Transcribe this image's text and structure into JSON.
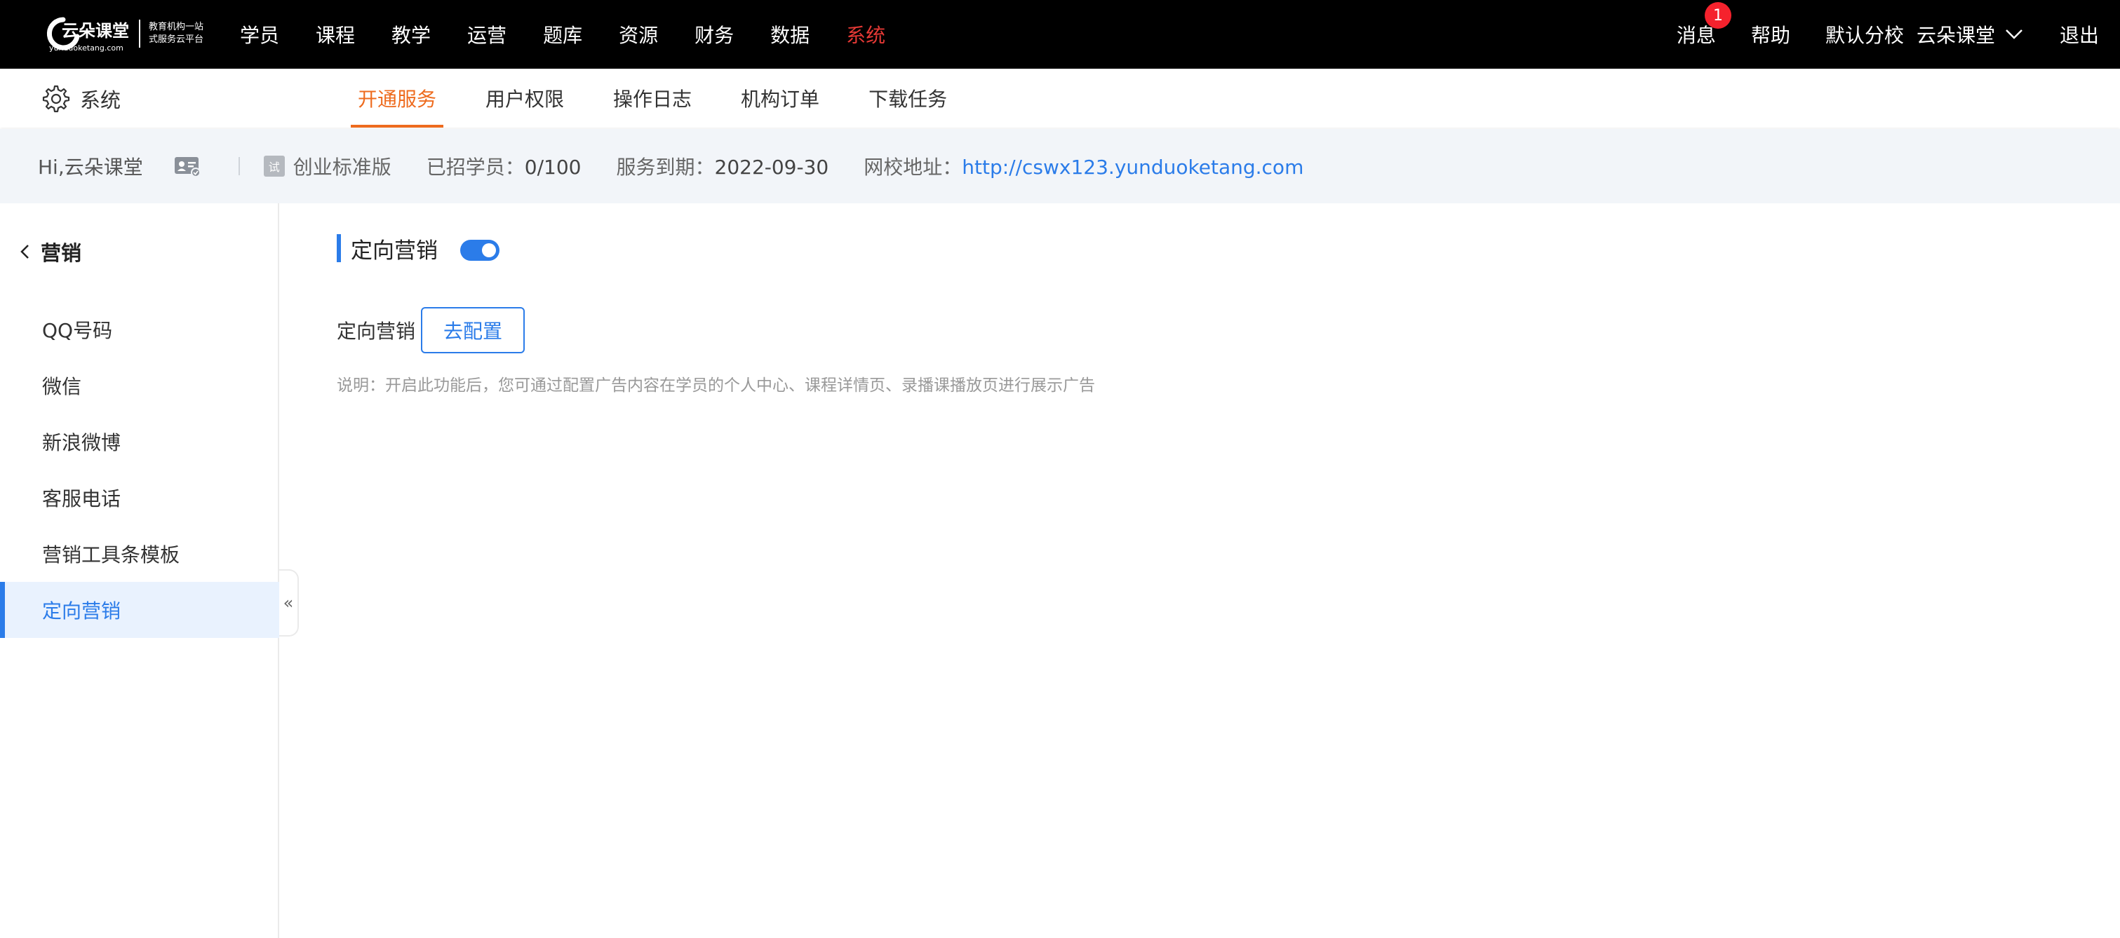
{
  "topbar": {
    "logo": {
      "name": "云朵课堂",
      "domain": "yunduoketang.com",
      "slogan_line1": "教育机构一站",
      "slogan_line2": "式服务云平台"
    },
    "nav": [
      {
        "label": "学员"
      },
      {
        "label": "课程"
      },
      {
        "label": "教学"
      },
      {
        "label": "运营"
      },
      {
        "label": "题库"
      },
      {
        "label": "资源"
      },
      {
        "label": "财务"
      },
      {
        "label": "数据"
      },
      {
        "label": "系统"
      }
    ],
    "active_nav": "系统",
    "messages_label": "消息",
    "messages_badge": "1",
    "help_label": "帮助",
    "campus_label": "默认分校",
    "account_label": "云朵课堂",
    "logout_label": "退出"
  },
  "subbar": {
    "section_label": "系统",
    "tabs": [
      {
        "label": "开通服务"
      },
      {
        "label": "用户权限"
      },
      {
        "label": "操作日志"
      },
      {
        "label": "机构订单"
      },
      {
        "label": "下载任务"
      }
    ],
    "active_tab": "开通服务"
  },
  "infobar": {
    "greeting": "Hi,云朵课堂",
    "trial_badge": "试",
    "edition": "创业标准版",
    "students_label": "已招学员：",
    "students_value": "0/100",
    "expiry_label": "服务到期：",
    "expiry_value": "2022-09-30",
    "site_label": "网校地址：",
    "site_url": "http://cswx123.yunduoketang.com"
  },
  "sidebar": {
    "back_label": "营销",
    "items": [
      {
        "label": "QQ号码"
      },
      {
        "label": "微信"
      },
      {
        "label": "新浪微博"
      },
      {
        "label": "客服电话"
      },
      {
        "label": "营销工具条模板"
      },
      {
        "label": "定向营销"
      }
    ],
    "active_item": "定向营销",
    "collapse_glyph": "«"
  },
  "main": {
    "title": "定向营销",
    "toggle_on": true,
    "config_label": "定向营销",
    "config_button": "去配置",
    "note": "说明：开启此功能后，您可通过配置广告内容在学员的个人中心、课程详情页、录播课播放页进行展示广告"
  },
  "colors": {
    "accent": "#2b7ce9",
    "active_tab": "#ee6b1e",
    "active_nav": "#e53935",
    "badge": "#f5222d"
  }
}
